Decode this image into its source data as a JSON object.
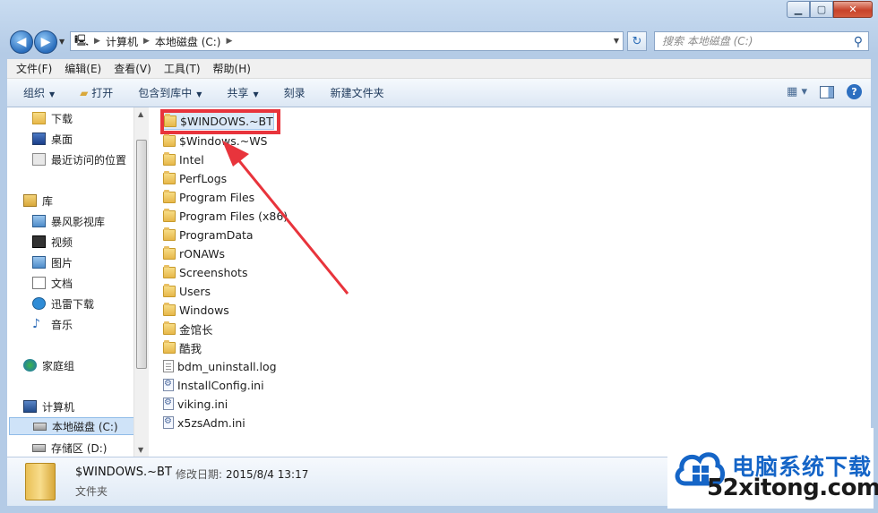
{
  "address": {
    "breadcrumb": [
      "计算机",
      "本地磁盘 (C:)"
    ],
    "search_placeholder": "搜索 本地磁盘 (C:)"
  },
  "menu": [
    "文件(F)",
    "编辑(E)",
    "查看(V)",
    "工具(T)",
    "帮助(H)"
  ],
  "toolbar": {
    "organize": "组织",
    "open": "打开",
    "include_library": "包含到库中",
    "share": "共享",
    "burn": "刻录",
    "new_folder": "新建文件夹"
  },
  "nav": {
    "favorites": [
      "下载",
      "桌面",
      "最近访问的位置"
    ],
    "libraries_label": "库",
    "libraries": [
      "暴风影视库",
      "视频",
      "图片",
      "文档",
      "迅雷下载",
      "音乐"
    ],
    "homegroup": "家庭组",
    "computer": "计算机",
    "drives": [
      "本地磁盘 (C:)",
      "存储区 (D:)"
    ]
  },
  "files": [
    {
      "name": "$WINDOWS.~BT",
      "type": "folder"
    },
    {
      "name": "$Windows.~WS",
      "type": "folder"
    },
    {
      "name": "Intel",
      "type": "folder"
    },
    {
      "name": "PerfLogs",
      "type": "folder"
    },
    {
      "name": "Program Files",
      "type": "folder"
    },
    {
      "name": "Program Files (x86)",
      "type": "folder"
    },
    {
      "name": "ProgramData",
      "type": "folder"
    },
    {
      "name": "rONAWs",
      "type": "folder"
    },
    {
      "name": "Screenshots",
      "type": "folder"
    },
    {
      "name": "Users",
      "type": "folder"
    },
    {
      "name": "Windows",
      "type": "folder"
    },
    {
      "name": "金馆长",
      "type": "folder"
    },
    {
      "name": "酷我",
      "type": "folder"
    },
    {
      "name": "bdm_uninstall.log",
      "type": "file"
    },
    {
      "name": "InstallConfig.ini",
      "type": "ini"
    },
    {
      "name": "viking.ini",
      "type": "ini"
    },
    {
      "name": "x5zsAdm.ini",
      "type": "ini"
    }
  ],
  "details": {
    "name": "$WINDOWS.~BT",
    "modified_label": "修改日期:",
    "modified_value": "2015/8/4 13:17",
    "type": "文件夹"
  },
  "watermark": {
    "cn": "电脑系统下载",
    "en": "52xitong.com"
  },
  "colors": {
    "highlight": "#e8343c",
    "selection": "#dbe9f8"
  }
}
